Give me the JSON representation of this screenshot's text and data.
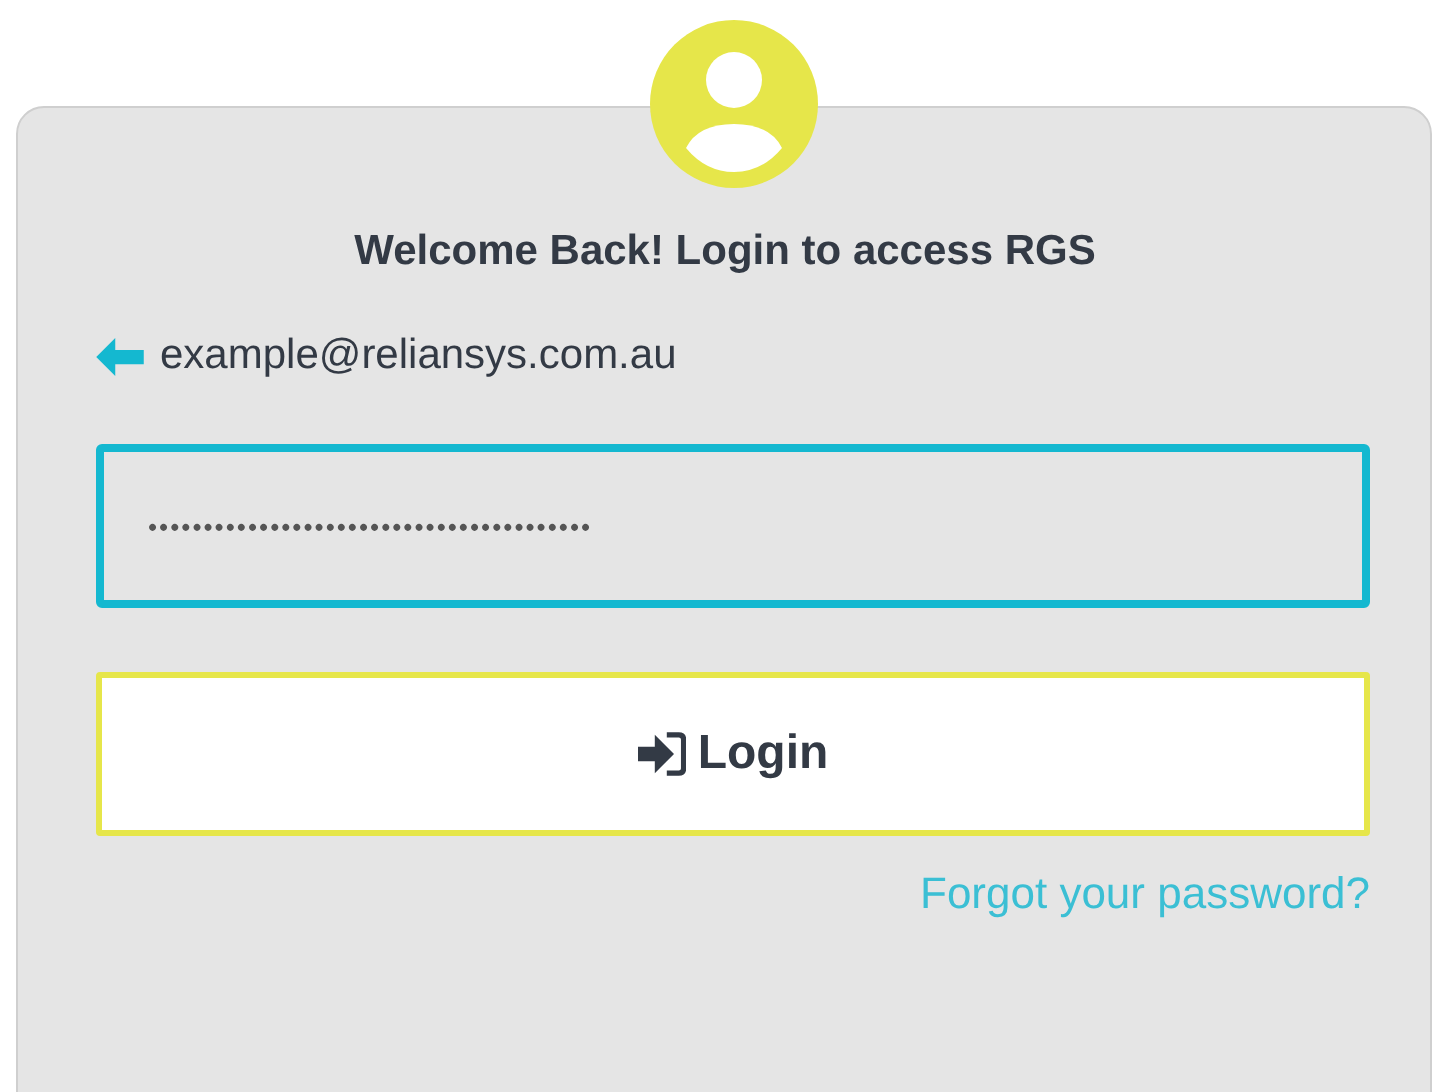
{
  "heading": "Welcome Back! Login to access RGS",
  "account": {
    "email": "example@reliansys.com.au"
  },
  "password": {
    "value": "••••••••••••••••••••••••••••••••••••••••",
    "focused": true
  },
  "login_button": {
    "label": "Login"
  },
  "forgot_link": {
    "label": "Forgot your password?"
  }
}
